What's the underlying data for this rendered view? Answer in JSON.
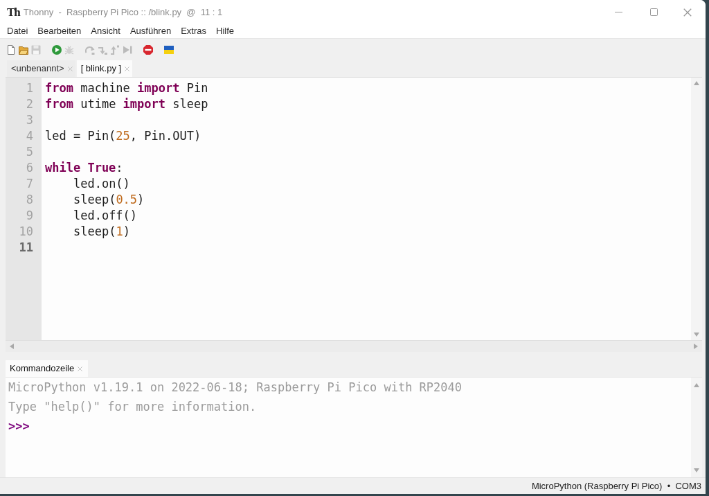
{
  "window": {
    "logo": "Th",
    "title": "Thonny  -  Raspberry Pi Pico :: /blink.py  @  11 : 1"
  },
  "menu": [
    "Datei",
    "Bearbeiten",
    "Ansicht",
    "Ausführen",
    "Extras",
    "Hilfe"
  ],
  "toolbar": [
    {
      "kind": "new",
      "disabled": false
    },
    {
      "kind": "open",
      "disabled": false
    },
    {
      "kind": "save",
      "disabled": true
    },
    {
      "kind": "run",
      "disabled": false
    },
    {
      "kind": "debug",
      "disabled": true
    },
    {
      "kind": "stepover",
      "disabled": true
    },
    {
      "kind": "stepinto",
      "disabled": true
    },
    {
      "kind": "stepout",
      "disabled": true
    },
    {
      "kind": "resume",
      "disabled": true
    },
    {
      "kind": "stop",
      "disabled": false
    },
    {
      "kind": "flag",
      "disabled": false
    }
  ],
  "editor": {
    "tabs": [
      {
        "label": "<unbenannt>",
        "selected": false
      },
      {
        "label": "[ blink.py ]",
        "selected": true
      }
    ],
    "lines": [
      {
        "number": "1",
        "current": false,
        "tokens": [
          {
            "kind": "keyword",
            "text": "from"
          },
          {
            "kind": "plain",
            "text": " machine "
          },
          {
            "kind": "keyword",
            "text": "import"
          },
          {
            "kind": "plain",
            "text": " Pin"
          }
        ]
      },
      {
        "number": "2",
        "current": false,
        "tokens": [
          {
            "kind": "keyword",
            "text": "from"
          },
          {
            "kind": "plain",
            "text": " utime "
          },
          {
            "kind": "keyword",
            "text": "import"
          },
          {
            "kind": "plain",
            "text": " sleep"
          }
        ]
      },
      {
        "number": "3",
        "current": false
      },
      {
        "number": "4",
        "current": false,
        "tokens": [
          {
            "kind": "plain",
            "text": "led = Pin("
          },
          {
            "kind": "number",
            "text": "25"
          },
          {
            "kind": "plain",
            "text": ", Pin.OUT)"
          }
        ]
      },
      {
        "number": "5",
        "current": false
      },
      {
        "number": "6",
        "current": false,
        "tokens": [
          {
            "kind": "keyword",
            "text": "while True"
          },
          {
            "kind": "plain",
            "text": ":"
          }
        ]
      },
      {
        "number": "7",
        "current": false,
        "tokens": [
          {
            "kind": "plain",
            "text": "    led.on()"
          }
        ]
      },
      {
        "number": "8",
        "current": false,
        "tokens": [
          {
            "kind": "plain",
            "text": "    sleep("
          },
          {
            "kind": "number",
            "text": "0.5"
          },
          {
            "kind": "plain",
            "text": ")"
          }
        ]
      },
      {
        "number": "9",
        "current": false,
        "tokens": [
          {
            "kind": "plain",
            "text": "    led.off()"
          }
        ]
      },
      {
        "number": "10",
        "current": false,
        "tokens": [
          {
            "kind": "plain",
            "text": "    sleep("
          },
          {
            "kind": "number",
            "text": "1"
          },
          {
            "kind": "plain",
            "text": ")"
          }
        ]
      },
      {
        "number": "11",
        "current": true
      }
    ]
  },
  "shell": {
    "tabs": [
      {
        "label": "Kommandozeile",
        "selected": true
      }
    ],
    "lines": [
      {
        "kind": "output",
        "text": "MicroPython v1.19.1 on 2022-06-18; Raspberry Pi Pico with RP2040"
      },
      {
        "kind": "output",
        "text": "Type \"help()\" for more information."
      },
      {
        "kind": "prompt",
        "text": ">>>"
      }
    ]
  },
  "status_bar": {
    "backend": "MicroPython (Raspberry Pi Pico)  •  COM3"
  }
}
